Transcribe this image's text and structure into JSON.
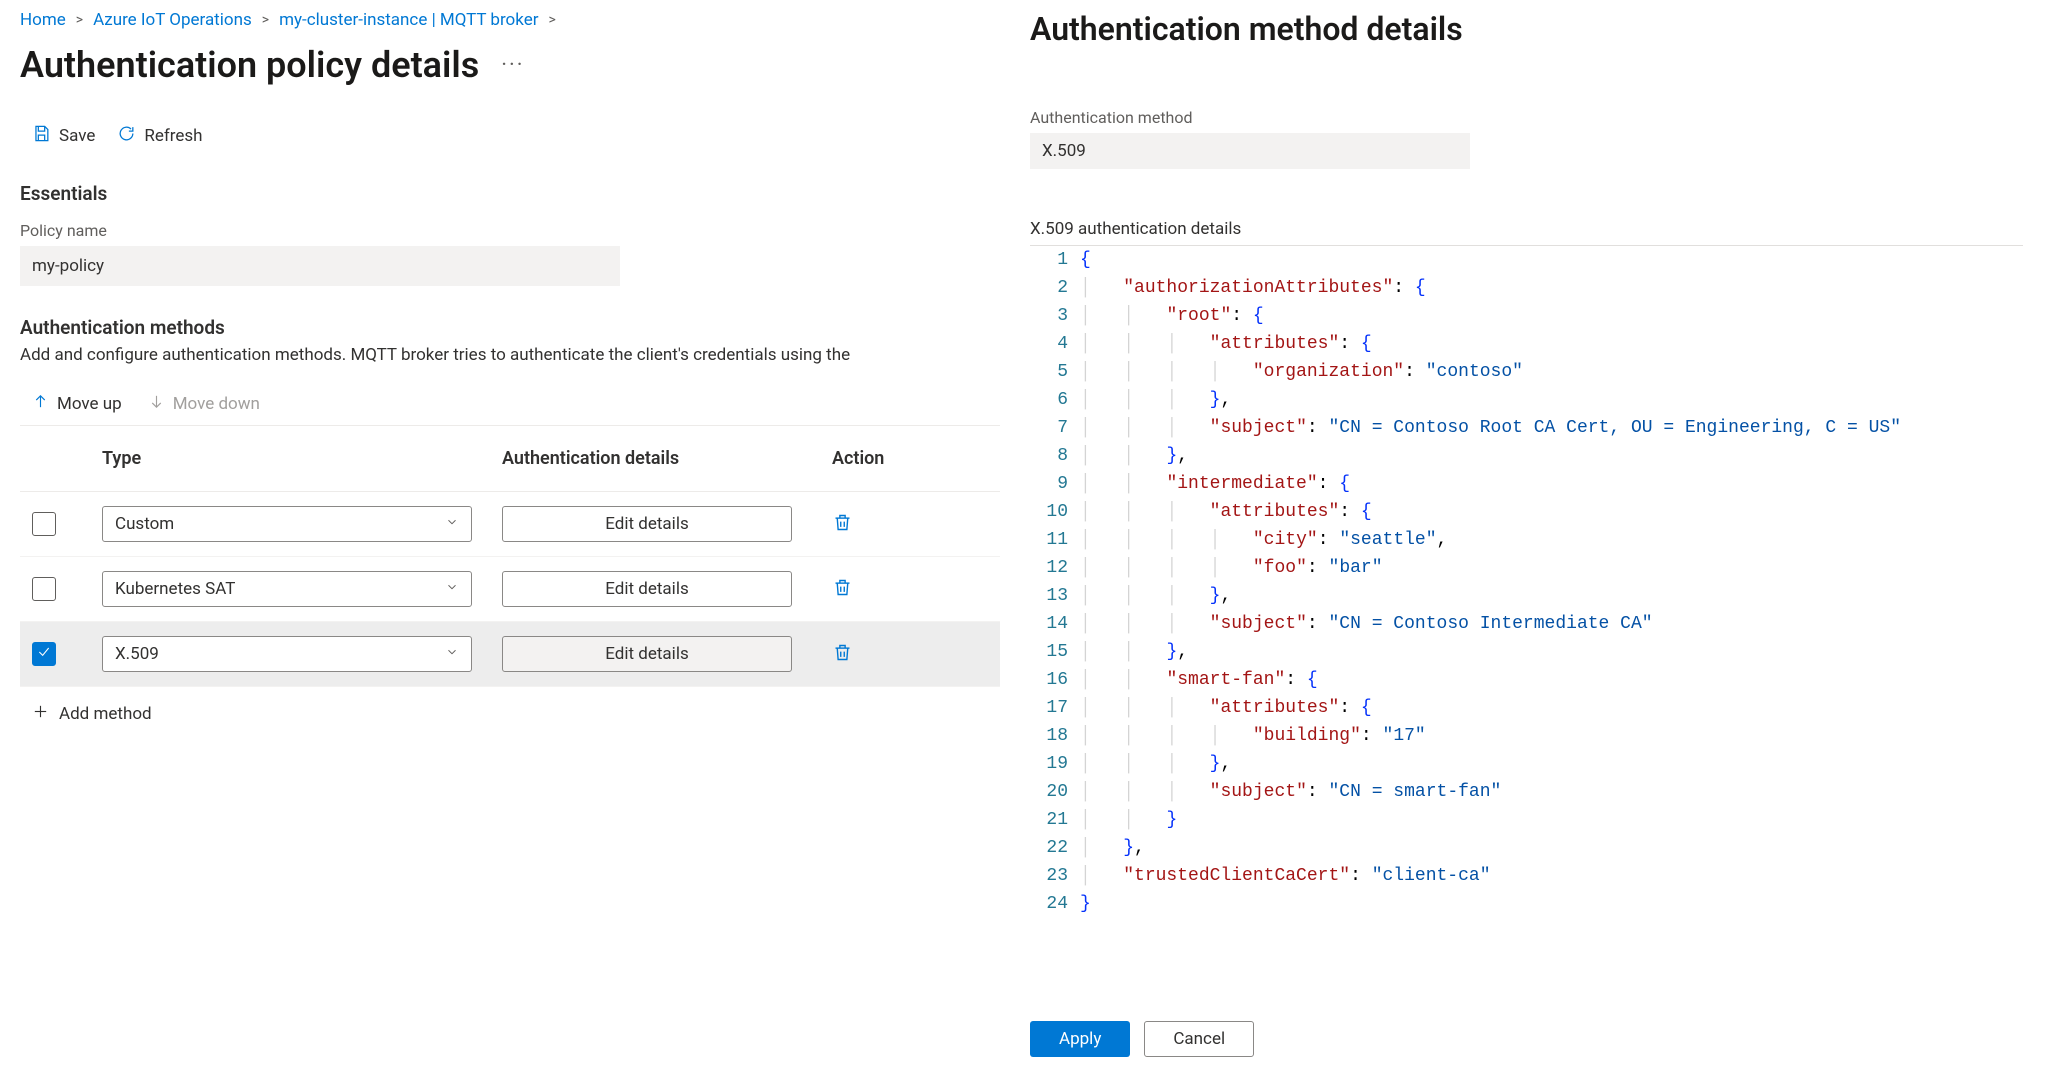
{
  "breadcrumb": {
    "items": [
      "Home",
      "Azure IoT Operations",
      "my-cluster-instance | MQTT broker"
    ]
  },
  "page_title": "Authentication policy details",
  "toolbar": {
    "save": "Save",
    "refresh": "Refresh"
  },
  "essentials": {
    "title": "Essentials",
    "policy_name_label": "Policy name",
    "policy_name_value": "my-policy"
  },
  "methods_section": {
    "title": "Authentication methods",
    "description": "Add and configure authentication methods. MQTT broker tries to authenticate the client's credentials using the",
    "move_up": "Move up",
    "move_down": "Move down",
    "headers": {
      "type": "Type",
      "details": "Authentication details",
      "action": "Action"
    },
    "rows": [
      {
        "type": "Custom",
        "edit": "Edit details",
        "selected": false
      },
      {
        "type": "Kubernetes SAT",
        "edit": "Edit details",
        "selected": false
      },
      {
        "type": "X.509",
        "edit": "Edit details",
        "selected": true
      }
    ],
    "add_method": "Add method"
  },
  "detail_pane": {
    "title": "Authentication method details",
    "auth_method_label": "Authentication method",
    "auth_method_value": "X.509",
    "json_label": "X.509 authentication details",
    "json_body": {
      "authorizationAttributes": {
        "root": {
          "attributes": {
            "organization": "contoso"
          },
          "subject": "CN = Contoso Root CA Cert, OU = Engineering, C = US"
        },
        "intermediate": {
          "attributes": {
            "city": "seattle",
            "foo": "bar"
          },
          "subject": "CN = Contoso Intermediate CA"
        },
        "smart-fan": {
          "attributes": {
            "building": "17"
          },
          "subject": "CN = smart-fan"
        }
      },
      "trustedClientCaCert": "client-ca"
    },
    "code_lines": [
      "{",
      "    \"authorizationAttributes\": {",
      "        \"root\": {",
      "            \"attributes\": {",
      "                \"organization\": \"contoso\"",
      "            },",
      "            \"subject\": \"CN = Contoso Root CA Cert, OU = Engineering, C = US\"",
      "        },",
      "        \"intermediate\": {",
      "            \"attributes\": {",
      "                \"city\": \"seattle\",",
      "                \"foo\": \"bar\"",
      "            },",
      "            \"subject\": \"CN = Contoso Intermediate CA\"",
      "        },",
      "        \"smart-fan\": {",
      "            \"attributes\": {",
      "                \"building\": \"17\"",
      "            },",
      "            \"subject\": \"CN = smart-fan\"",
      "        }",
      "    },",
      "    \"trustedClientCaCert\": \"client-ca\"",
      "}"
    ],
    "apply": "Apply",
    "cancel": "Cancel"
  }
}
